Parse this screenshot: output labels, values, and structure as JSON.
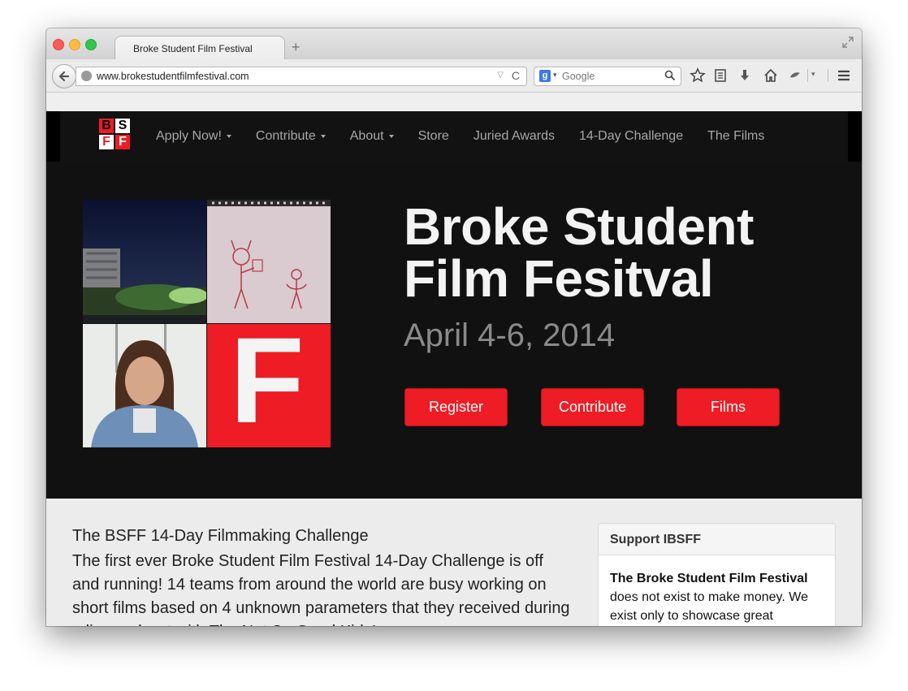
{
  "browser": {
    "tab_title": "Broke Student Film Festival",
    "new_tab_symbol": "+",
    "url": "www.brokestudentfilmfestival.com",
    "search_engine_letter": "g",
    "search_placeholder": "Google",
    "reload_symbol": "C"
  },
  "site": {
    "logo_letters": [
      "B",
      "S",
      "F",
      "F"
    ],
    "nav": [
      {
        "label": "Apply Now!",
        "dropdown": true
      },
      {
        "label": "Contribute",
        "dropdown": true
      },
      {
        "label": "About",
        "dropdown": true
      },
      {
        "label": "Store",
        "dropdown": false
      },
      {
        "label": "Juried Awards",
        "dropdown": false
      },
      {
        "label": "14-Day Challenge",
        "dropdown": false
      },
      {
        "label": "The Films",
        "dropdown": false
      }
    ]
  },
  "hero": {
    "title_line1": "Broke Student",
    "title_line2": "Film Fesitval",
    "date": "April 4-6, 2014",
    "collage_letter": "F",
    "buttons": [
      "Register",
      "Contribute",
      "Films"
    ]
  },
  "article": {
    "title": "The BSFF 14-Day Filmmaking Challenge",
    "body": "The first ever Broke Student Film Festival 14-Day Challenge is off and running! 14 teams from around the world are busy working on short films based on 4 unknown parameters that they received during a live podcast with The Not So Good Kids!"
  },
  "sidebar": {
    "panel_title": "Support IBSFF",
    "panel_bold": "The Broke Student Film Festival",
    "panel_text": " does not exist to make money. We exist only to showcase great"
  },
  "colors": {
    "brand_red": "#ee1c24",
    "nav_bg": "#121212",
    "hero_bg": "#111111"
  }
}
